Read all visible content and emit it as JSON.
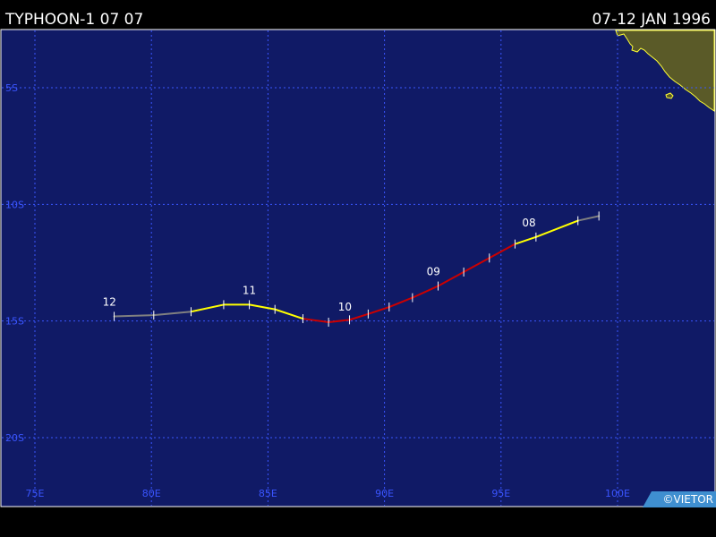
{
  "header": {
    "storm_name": "TYPHOON-1 07 07",
    "date_range": "07-12 JAN 1996"
  },
  "map": {
    "lon_labels": [
      "75E",
      "80E",
      "85E",
      "90E",
      "95E",
      "100E"
    ],
    "lat_labels": [
      "5S",
      "10S",
      "15S",
      "20S"
    ],
    "lon_values": [
      75,
      80,
      85,
      90,
      95,
      100
    ],
    "lat_values": [
      5,
      10,
      15,
      20
    ],
    "ocean_color": "#101a66",
    "grid_color": "#3a55ff",
    "land_color": "#5a5a28",
    "coast_color": "#ffff33"
  },
  "track": {
    "points": [
      {
        "lon": 99.2,
        "lat": 10.5,
        "category": "depression"
      },
      {
        "lon": 98.3,
        "lat": 10.7,
        "category": "storm"
      },
      {
        "lon": 96.5,
        "lat": 11.4,
        "category": "storm"
      },
      {
        "lon": 95.6,
        "lat": 11.7,
        "category": "storm"
      },
      {
        "lon": 94.5,
        "lat": 12.3,
        "category": "typhoon"
      },
      {
        "lon": 93.4,
        "lat": 12.9,
        "category": "typhoon"
      },
      {
        "lon": 92.3,
        "lat": 13.5,
        "category": "typhoon"
      },
      {
        "lon": 91.2,
        "lat": 14.0,
        "category": "typhoon"
      },
      {
        "lon": 90.2,
        "lat": 14.4,
        "category": "typhoon"
      },
      {
        "lon": 89.3,
        "lat": 14.7,
        "category": "typhoon"
      },
      {
        "lon": 88.5,
        "lat": 14.95,
        "category": "typhoon"
      },
      {
        "lon": 87.6,
        "lat": 15.05,
        "category": "typhoon"
      },
      {
        "lon": 86.5,
        "lat": 14.9,
        "category": "storm"
      },
      {
        "lon": 85.3,
        "lat": 14.5,
        "category": "storm"
      },
      {
        "lon": 84.2,
        "lat": 14.3,
        "category": "storm"
      },
      {
        "lon": 83.1,
        "lat": 14.3,
        "category": "storm"
      },
      {
        "lon": 81.7,
        "lat": 14.6,
        "category": "storm"
      },
      {
        "lon": 80.1,
        "lat": 14.75,
        "category": "depression"
      },
      {
        "lon": 78.4,
        "lat": 14.8,
        "category": "depression"
      }
    ],
    "day_labels": [
      {
        "text": "08",
        "lon": 96.2,
        "lat": 11.1
      },
      {
        "text": "09",
        "lon": 92.1,
        "lat": 13.2
      },
      {
        "text": "10",
        "lon": 88.3,
        "lat": 14.7
      },
      {
        "text": "11",
        "lon": 84.2,
        "lat": 14.0
      },
      {
        "text": "12",
        "lon": 78.2,
        "lat": 14.5
      }
    ],
    "colors": {
      "depression": "#808080",
      "storm": "#ffff00",
      "typhoon": "#cc0000"
    }
  },
  "footer": {
    "copyright": "©VIETOR"
  }
}
